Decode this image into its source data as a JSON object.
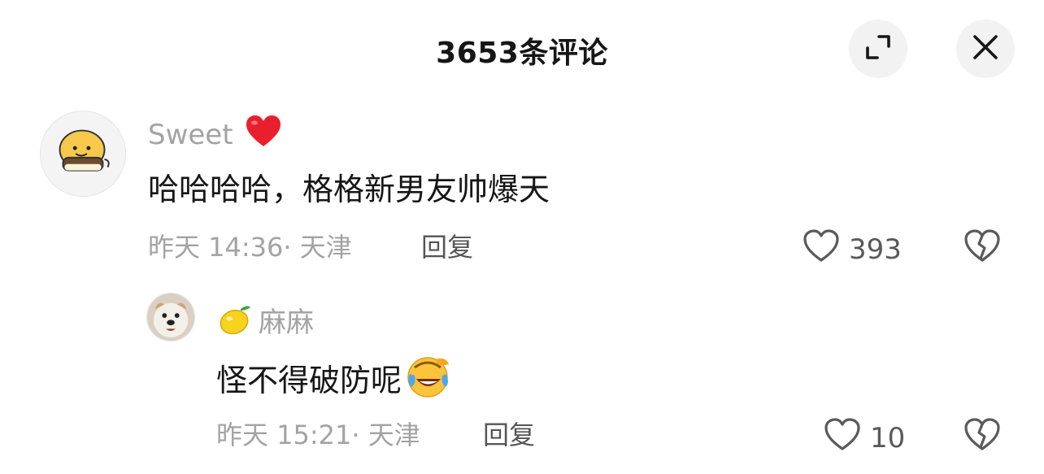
{
  "header": {
    "title": "3653条评论",
    "expand_icon": "expand-icon",
    "close_icon": "close-icon"
  },
  "comments": [
    {
      "author": "Sweet",
      "author_emoji": "red-heart-icon",
      "avatar": "cartoon-bun-avatar",
      "content": "哈哈哈哈，格格新男友帅爆天",
      "time_location": "昨天 14:36· 天津",
      "reply_label": "回复",
      "likes": "393"
    },
    {
      "author": "麻麻",
      "author_emoji": "lemon-icon",
      "avatar": "dog-avatar",
      "content": "怪不得破防呢",
      "content_emoji": "laughing-crying-face-icon",
      "time_location": "昨天 15:21· 天津",
      "reply_label": "回复",
      "likes": "10"
    }
  ],
  "colors": {
    "text": "#161616",
    "muted": "#a3a3a3",
    "button_bg": "#f2f2f2",
    "heart_red": "#e8202e"
  }
}
